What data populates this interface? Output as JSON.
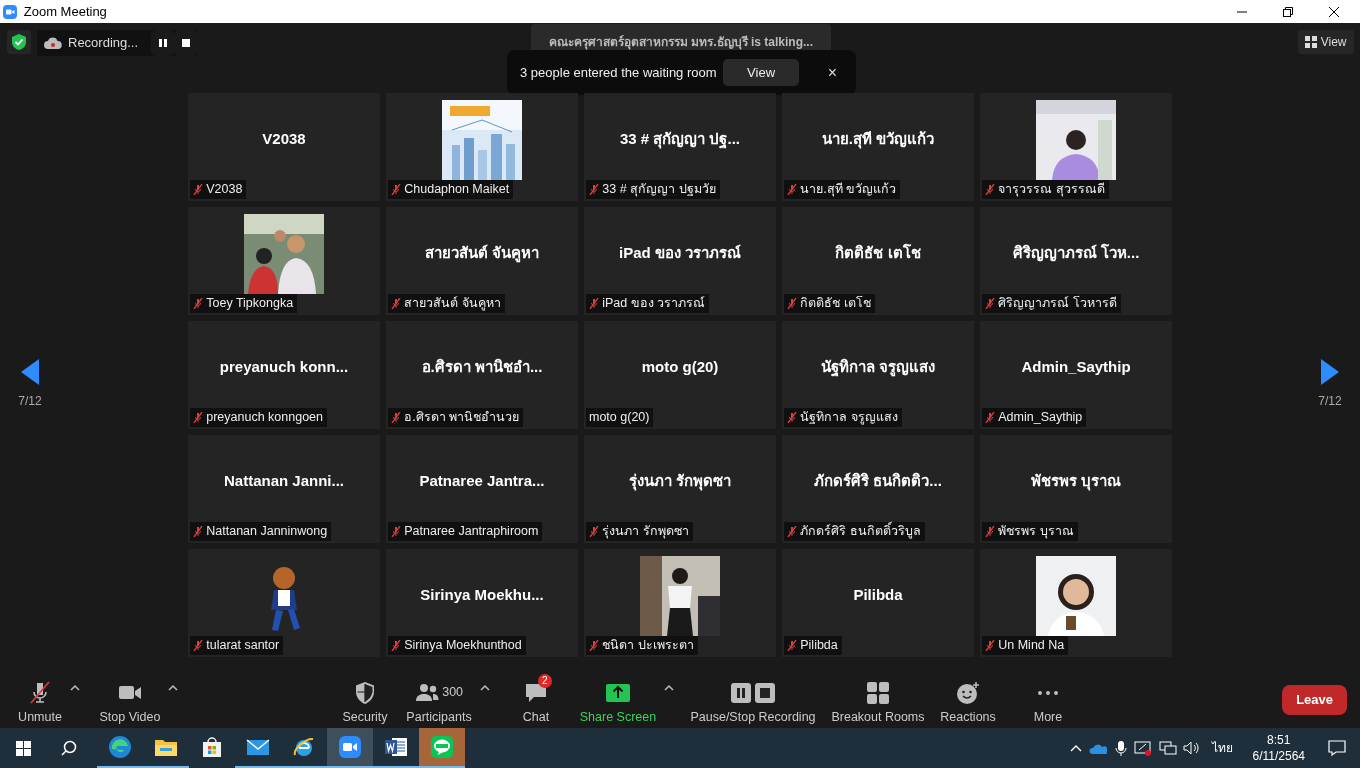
{
  "window": {
    "title": "Zoom Meeting"
  },
  "top_bar": {
    "recording_label": "Recording...",
    "view_label": "View"
  },
  "speaker_banner": {
    "text": "คณะครุศาสตร์อุตสาหกรรม มทร.ธัญบุรี is talking..."
  },
  "notification": {
    "text": "3 people entered the waiting room",
    "button": "View",
    "close": "×"
  },
  "pager": {
    "left": "7/12",
    "right": "7/12"
  },
  "tiles": [
    {
      "kind": "name",
      "title": "V2038",
      "label": "V2038",
      "muted": true
    },
    {
      "kind": "picture",
      "label": "Chudaphon Maiket",
      "muted": true
    },
    {
      "kind": "name",
      "title": "33 # สุกัญญา ปฐ...",
      "label": "33 # สุกัญญา ปฐมวัย",
      "muted": true
    },
    {
      "kind": "name",
      "title": "นาย.สุที ขวัญแก้ว",
      "label": "นาย.สุที ขวัญแก้ว",
      "muted": true
    },
    {
      "kind": "picture",
      "label": "จารุวรรณ สุวรรณดี",
      "muted": true
    },
    {
      "kind": "picture",
      "label": "Toey Tipkongka",
      "muted": true
    },
    {
      "kind": "name",
      "title": "สายวสันต์ จันคูหา",
      "label": "สายวสันต์ จันคูหา",
      "muted": true
    },
    {
      "kind": "name",
      "title": "iPad ของ วราภรณ์",
      "label": "iPad ของ วราภรณ์",
      "muted": true
    },
    {
      "kind": "name",
      "title": "กิตติธัช เตโช",
      "label": "กิตติธัช เตโช",
      "muted": true
    },
    {
      "kind": "name",
      "title": "ศิริญญาภรณ์ โวห...",
      "label": "ศิริญญาภรณ์ โวหารดี",
      "muted": true
    },
    {
      "kind": "name",
      "title": "preyanuch  konn...",
      "label": "preyanuch konngoen",
      "muted": true
    },
    {
      "kind": "name",
      "title": "อ.ศิรดา  พานิชอำ...",
      "label": "อ.ศิรดา  พานิชอำนวย",
      "muted": true
    },
    {
      "kind": "name",
      "title": "moto g(20)",
      "label": "moto g(20)",
      "muted": false
    },
    {
      "kind": "name",
      "title": "นัฐทิกาล จรูญแสง",
      "label": "นัฐทิกาล จรูญแสง",
      "muted": true
    },
    {
      "kind": "name",
      "title": "Admin_Saythip",
      "label": "Admin_Saythip",
      "muted": true
    },
    {
      "kind": "name",
      "title": "Nattanan  Janni...",
      "label": "Nattanan Janninwong",
      "muted": true
    },
    {
      "kind": "name",
      "title": "Patnaree  Jantra...",
      "label": "Patnaree Jantraphiroom",
      "muted": true
    },
    {
      "kind": "name",
      "title": "รุ่งนภา รักพุดซา",
      "label": "รุ่งนภา รักพุดซา",
      "muted": true
    },
    {
      "kind": "name",
      "title": "ภักดร์ศิริ ธนกิตติว...",
      "label": "ภักดร์ศิริ ธนกิตติ์วริบูล",
      "muted": true
    },
    {
      "kind": "name",
      "title": "พัชรพร บุราณ",
      "label": "พัชรพร บุราณ",
      "muted": true
    },
    {
      "kind": "picture",
      "label": "tularat santor",
      "muted": true
    },
    {
      "kind": "name",
      "title": "Sirinya  Moekhu...",
      "label": "Sirinya Moekhunthod",
      "muted": true
    },
    {
      "kind": "picture",
      "label": "ชนิดา ปะเพระตา",
      "muted": true
    },
    {
      "kind": "name",
      "title": "Pilibda",
      "label": "Pilibda",
      "muted": true
    },
    {
      "kind": "picture",
      "label": "Un Mind Na",
      "muted": true
    }
  ],
  "toolbar": [
    {
      "kind": "mic",
      "label": "Unmute",
      "caret": true
    },
    {
      "kind": "video",
      "label": "Stop Video",
      "caret": true
    },
    {
      "kind": "security",
      "label": "Security",
      "caret": false
    },
    {
      "kind": "participants",
      "label": "Participants",
      "count": "300",
      "caret": true
    },
    {
      "kind": "chat",
      "label": "Chat",
      "badge": "2",
      "caret": false
    },
    {
      "kind": "share",
      "label": "Share Screen",
      "caret": true
    },
    {
      "kind": "recording",
      "label": "Pause/Stop Recording",
      "caret": false
    },
    {
      "kind": "breakout",
      "label": "Breakout Rooms",
      "caret": false
    },
    {
      "kind": "reactions",
      "label": "Reactions",
      "caret": false
    },
    {
      "kind": "more",
      "label": "More",
      "caret": false
    }
  ],
  "leave_button": "Leave",
  "taskbar": {
    "apps": [
      {
        "kind": "edge",
        "running": true,
        "selected": false,
        "flashing": false
      },
      {
        "kind": "explorer",
        "running": true,
        "selected": false,
        "flashing": false
      },
      {
        "kind": "store",
        "running": false,
        "selected": false,
        "flashing": false
      },
      {
        "kind": "mail",
        "running": true,
        "selected": false,
        "flashing": false
      },
      {
        "kind": "ie",
        "running": true,
        "selected": false,
        "flashing": false
      },
      {
        "kind": "zoom",
        "running": true,
        "selected": true,
        "flashing": false
      },
      {
        "kind": "word",
        "running": true,
        "selected": false,
        "flashing": false
      },
      {
        "kind": "line",
        "running": true,
        "selected": false,
        "flashing": true
      }
    ],
    "language": "ไทย",
    "time": "8:51",
    "date": "6/11/2564"
  }
}
